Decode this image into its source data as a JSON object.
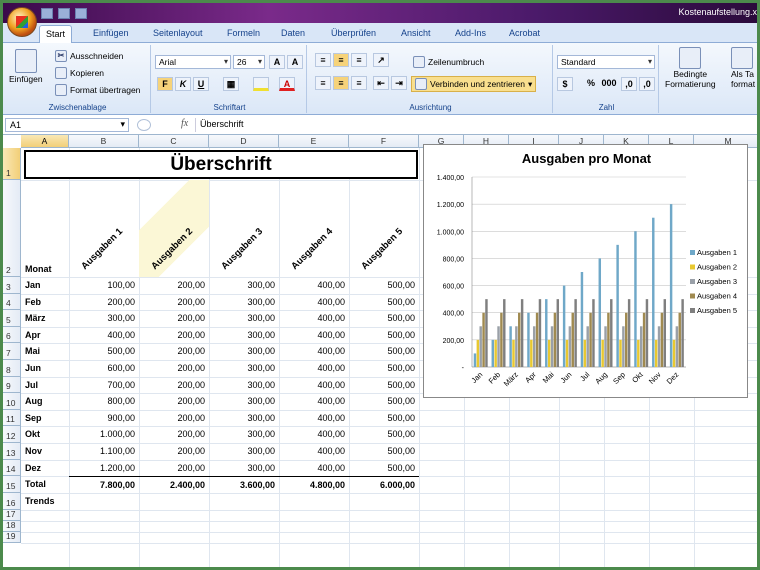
{
  "window": {
    "title": "Kostenaufstellung.x"
  },
  "tabs": [
    "Start",
    "Einfügen",
    "Seitenlayout",
    "Formeln",
    "Daten",
    "Überprüfen",
    "Ansicht",
    "Add-Ins",
    "Acrobat"
  ],
  "ribbon": {
    "paste_label": "Einfügen",
    "cut_label": "Ausschneiden",
    "copy_label": "Kopieren",
    "format_painter_label": "Format übertragen",
    "clipboard_group": "Zwischenablage",
    "font_name": "Arial",
    "font_size": "26",
    "font_group": "Schriftart",
    "bold_label": "F",
    "italic_label": "K",
    "underline_label": "U",
    "wrap_text_label": "Zeilenumbruch",
    "merge_center_label": "Verbinden und zentrieren",
    "alignment_group": "Ausrichtung",
    "number_format": "Standard",
    "percent_label": "%",
    "thousands_label": "000",
    "number_group": "Zahl",
    "cond_format_label_1": "Bedingte",
    "cond_format_label_2": "Formatierung",
    "as_table_label_1": "Als Ta",
    "as_table_label_2": "format"
  },
  "formula_bar": {
    "name_box": "A1",
    "fx": "fx",
    "content": "Überschrift"
  },
  "columns": [
    "A",
    "B",
    "C",
    "D",
    "E",
    "F",
    "G",
    "H",
    "I",
    "J",
    "K",
    "L",
    "M"
  ],
  "sheet": {
    "title": "Überschrift",
    "month_header": "Monat",
    "series_headers": [
      "Ausgaben 1",
      "Ausgaben 2",
      "Ausgaben 3",
      "Ausgaben 4",
      "Ausgaben 5"
    ],
    "rows": [
      {
        "n": "3",
        "month": "Jan",
        "v": [
          "100,00",
          "200,00",
          "300,00",
          "400,00",
          "500,00"
        ]
      },
      {
        "n": "4",
        "month": "Feb",
        "v": [
          "200,00",
          "200,00",
          "300,00",
          "400,00",
          "500,00"
        ]
      },
      {
        "n": "5",
        "month": "März",
        "v": [
          "300,00",
          "200,00",
          "300,00",
          "400,00",
          "500,00"
        ]
      },
      {
        "n": "6",
        "month": "Apr",
        "v": [
          "400,00",
          "200,00",
          "300,00",
          "400,00",
          "500,00"
        ]
      },
      {
        "n": "7",
        "month": "Mai",
        "v": [
          "500,00",
          "200,00",
          "300,00",
          "400,00",
          "500,00"
        ]
      },
      {
        "n": "8",
        "month": "Jun",
        "v": [
          "600,00",
          "200,00",
          "300,00",
          "400,00",
          "500,00"
        ]
      },
      {
        "n": "9",
        "month": "Jul",
        "v": [
          "700,00",
          "200,00",
          "300,00",
          "400,00",
          "500,00"
        ]
      },
      {
        "n": "10",
        "month": "Aug",
        "v": [
          "800,00",
          "200,00",
          "300,00",
          "400,00",
          "500,00"
        ]
      },
      {
        "n": "11",
        "month": "Sep",
        "v": [
          "900,00",
          "200,00",
          "300,00",
          "400,00",
          "500,00"
        ]
      },
      {
        "n": "12",
        "month": "Okt",
        "v": [
          "1.000,00",
          "200,00",
          "300,00",
          "400,00",
          "500,00"
        ]
      },
      {
        "n": "13",
        "month": "Nov",
        "v": [
          "1.100,00",
          "200,00",
          "300,00",
          "400,00",
          "500,00"
        ]
      },
      {
        "n": "14",
        "month": "Dez",
        "v": [
          "1.200,00",
          "200,00",
          "300,00",
          "400,00",
          "500,00"
        ]
      }
    ],
    "total": {
      "n": "15",
      "label": "Total",
      "v": [
        "7.800,00",
        "2.400,00",
        "3.600,00",
        "4.800,00",
        "6.000,00"
      ]
    },
    "trends_label": "Trends",
    "extra_rows": [
      "16",
      "17",
      "18",
      "19"
    ]
  },
  "chart_data": {
    "type": "bar",
    "title": "Ausgaben pro Monat",
    "categories": [
      "Jan",
      "Feb",
      "März",
      "Apr",
      "Mai",
      "Jun",
      "Jul",
      "Aug",
      "Sep",
      "Okt",
      "Nov",
      "Dez"
    ],
    "series": [
      {
        "name": "Ausgaben 1",
        "color": "#6fa8c8",
        "values": [
          100,
          200,
          300,
          400,
          500,
          600,
          700,
          800,
          900,
          1000,
          1100,
          1200
        ]
      },
      {
        "name": "Ausgaben 2",
        "color": "#e8c830",
        "values": [
          200,
          200,
          200,
          200,
          200,
          200,
          200,
          200,
          200,
          200,
          200,
          200
        ]
      },
      {
        "name": "Ausgaben 3",
        "color": "#9aa0a8",
        "values": [
          300,
          300,
          300,
          300,
          300,
          300,
          300,
          300,
          300,
          300,
          300,
          300
        ]
      },
      {
        "name": "Ausgaben 4",
        "color": "#a08a50",
        "values": [
          400,
          400,
          400,
          400,
          400,
          400,
          400,
          400,
          400,
          400,
          400,
          400
        ]
      },
      {
        "name": "Ausgaben 5",
        "color": "#7f7f7f",
        "values": [
          500,
          500,
          500,
          500,
          500,
          500,
          500,
          500,
          500,
          500,
          500,
          500
        ]
      }
    ],
    "ylim": [
      0,
      1400
    ],
    "yticks": [
      "-",
      "200,00",
      "400,00",
      "600,00",
      "800,00",
      "1.000,00",
      "1.200,00",
      "1.400,00"
    ],
    "grid": true,
    "legend": "right"
  }
}
